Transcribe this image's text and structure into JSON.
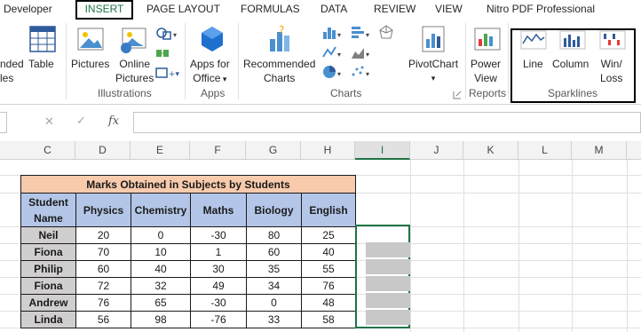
{
  "ribbon_tabs": {
    "developer": "Developer",
    "insert": "INSERT",
    "page_layout": "PAGE LAYOUT",
    "formulas": "FORMULAS",
    "data": "DATA",
    "review": "REVIEW",
    "view": "VIEW",
    "nitro": "Nitro PDF Professional"
  },
  "ribbon": {
    "tables_partial_1": "nded",
    "tables_partial_2": "les",
    "table": "Table",
    "pictures": "Pictures",
    "online_1": "Online",
    "online_2": "Pictures",
    "illustrations": "Illustrations",
    "apps_1": "Apps for",
    "apps_2": "Office",
    "apps_group": "Apps",
    "rec_1": "Recommended",
    "rec_2": "Charts",
    "pivotchart": "PivotChart",
    "charts_group": "Charts",
    "power_1": "Power",
    "power_2": "View",
    "reports_group": "Reports",
    "line": "Line",
    "column": "Column",
    "win_1": "Win/",
    "win_2": "Loss",
    "sparklines_group": "Sparklines"
  },
  "formula_bar": {
    "cancel": "✕",
    "enter": "✓",
    "fx": "fx",
    "value": ""
  },
  "columns": [
    "C",
    "D",
    "E",
    "F",
    "G",
    "H",
    "I",
    "J",
    "K",
    "L",
    "M"
  ],
  "active_column": "I",
  "table": {
    "title": "Marks Obtained in Subjects by Students",
    "headers": [
      "Student Name",
      "Physics",
      "Chemistry",
      "Maths",
      "Biology",
      "English"
    ],
    "rows": [
      [
        "Neil",
        "20",
        "0",
        "-30",
        "80",
        "25"
      ],
      [
        "Fiona",
        "70",
        "10",
        "1",
        "60",
        "40"
      ],
      [
        "Philip",
        "60",
        "40",
        "30",
        "35",
        "55"
      ],
      [
        "Fiona",
        "72",
        "32",
        "49",
        "34",
        "76"
      ],
      [
        "Andrew",
        "76",
        "65",
        "-30",
        "0",
        "48"
      ],
      [
        "Linda",
        "56",
        "98",
        "-76",
        "33",
        "58"
      ]
    ]
  },
  "colors": {
    "accent": "#217346",
    "title_fill": "#f8cbad",
    "header_fill": "#b4c6e7",
    "name_fill": "#d0cece",
    "selected_fill": "#c8c8c8"
  }
}
